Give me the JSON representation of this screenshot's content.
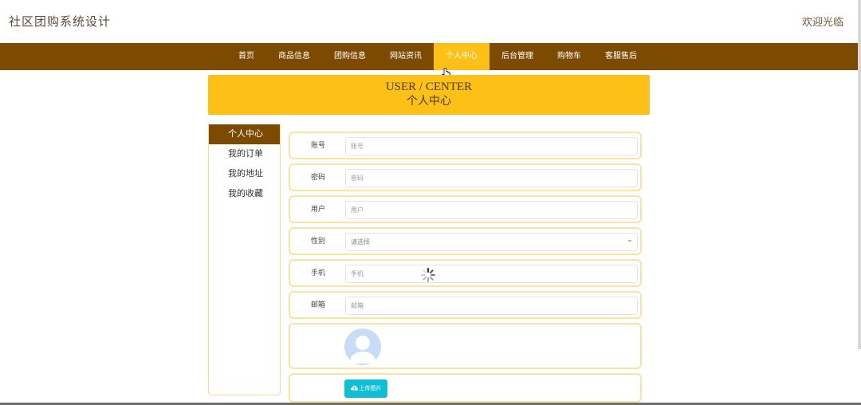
{
  "header": {
    "title": "社区团购系统设计",
    "welcome": "欢迎光临"
  },
  "nav": {
    "items": [
      "首页",
      "商品信息",
      "团购信息",
      "网站资讯",
      "个人中心",
      "后台管理",
      "购物车",
      "客服售后"
    ],
    "active": "个人中心"
  },
  "banner": {
    "title_en": "USER / CENTER",
    "title_cn": "个人中心"
  },
  "side_menu": {
    "items": [
      "个人中心",
      "我的订单",
      "我的地址",
      "我的收藏"
    ],
    "active": "个人中心"
  },
  "form": {
    "account": {
      "label": "账号",
      "placeholder": "账号"
    },
    "password": {
      "label": "密码",
      "placeholder": "密码"
    },
    "user": {
      "label": "用户",
      "placeholder": "用户"
    },
    "gender": {
      "label": "性别",
      "placeholder": "请选择"
    },
    "phone": {
      "label": "手机",
      "placeholder": "手机"
    },
    "email": {
      "label": "邮箱",
      "placeholder": "邮箱"
    },
    "upload_label": "上传图片"
  },
  "icons": {
    "avatar": "user-avatar-icon",
    "upload": "cloud-upload-icon",
    "spinner": "loading-spinner-icon",
    "cursor": "hand-pointer-icon"
  },
  "colors": {
    "nav_bg": "#7d4a02",
    "accent": "#fdc017",
    "upload_btn": "#11bfd4",
    "row_border": "#fbe3a3"
  }
}
